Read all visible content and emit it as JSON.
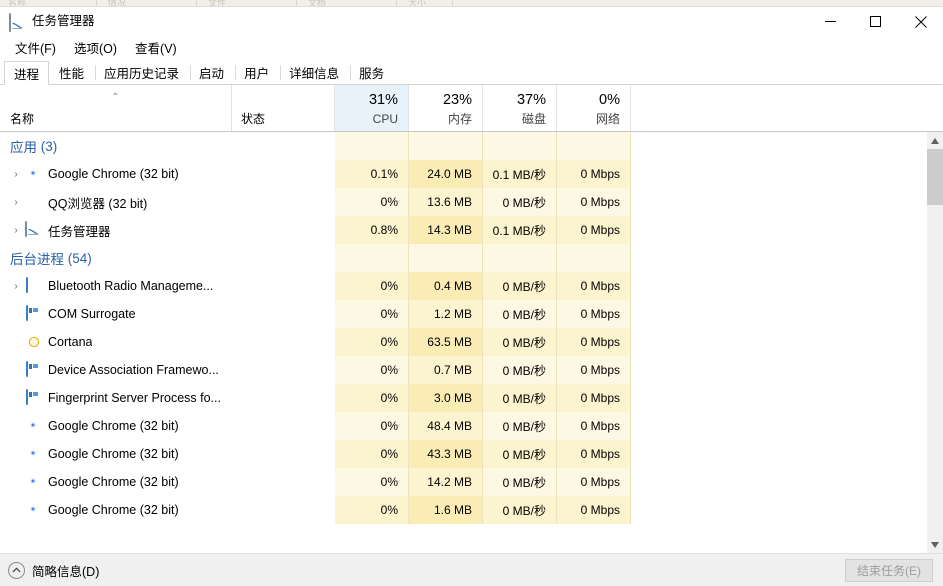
{
  "background_strip": {
    "segments": [
      "名称",
      "情况",
      "文件",
      "文档",
      "大小"
    ]
  },
  "window": {
    "title": "任务管理器",
    "icon": "task-manager-icon",
    "controls": {
      "minimize": "minimize-icon",
      "maximize": "maximize-icon",
      "close": "close-icon"
    }
  },
  "menu": {
    "items": [
      {
        "label": "文件(F)"
      },
      {
        "label": "选项(O)"
      },
      {
        "label": "查看(V)"
      }
    ]
  },
  "tabs": [
    {
      "label": "进程",
      "active": true
    },
    {
      "label": "性能",
      "active": false
    },
    {
      "label": "应用历史记录",
      "active": false
    },
    {
      "label": "启动",
      "active": false
    },
    {
      "label": "用户",
      "active": false
    },
    {
      "label": "详细信息",
      "active": false
    },
    {
      "label": "服务",
      "active": false
    }
  ],
  "columns": {
    "name": {
      "label": "名称",
      "sort": "ascending",
      "sort_glyph": "⌃"
    },
    "status": {
      "label": "状态"
    },
    "cpu": {
      "label": "CPU",
      "percent": "31%",
      "highlighted": true
    },
    "memory": {
      "label": "内存",
      "percent": "23%"
    },
    "disk": {
      "label": "磁盘",
      "percent": "37%"
    },
    "network": {
      "label": "网络",
      "percent": "0%"
    }
  },
  "groups": [
    {
      "label": "应用",
      "count": "(3)",
      "rows": [
        {
          "name": "Google Chrome (32 bit)",
          "icon": "chrome-icon",
          "expandable": true,
          "status": "",
          "cpu": "0.1%",
          "memory": "24.0 MB",
          "disk": "0.1 MB/秒",
          "network": "0 Mbps"
        },
        {
          "name": "QQ浏览器 (32 bit)",
          "icon": "qq-browser-icon",
          "expandable": true,
          "status": "",
          "cpu": "0%",
          "memory": "13.6 MB",
          "disk": "0 MB/秒",
          "network": "0 Mbps"
        },
        {
          "name": "任务管理器",
          "icon": "task-manager-icon",
          "expandable": true,
          "status": "",
          "cpu": "0.8%",
          "memory": "14.3 MB",
          "disk": "0.1 MB/秒",
          "network": "0 Mbps"
        }
      ]
    },
    {
      "label": "后台进程",
      "count": "(54)",
      "rows": [
        {
          "name": "Bluetooth Radio Manageme...",
          "icon": "window-icon",
          "expandable": true,
          "status": "",
          "cpu": "0%",
          "memory": "0.4 MB",
          "disk": "0 MB/秒",
          "network": "0 Mbps"
        },
        {
          "name": "COM Surrogate",
          "icon": "app-icon",
          "expandable": false,
          "status": "",
          "cpu": "0%",
          "memory": "1.2 MB",
          "disk": "0 MB/秒",
          "network": "0 Mbps"
        },
        {
          "name": "Cortana",
          "icon": "cortana-icon",
          "expandable": false,
          "status": "",
          "cpu": "0%",
          "memory": "63.5 MB",
          "disk": "0 MB/秒",
          "network": "0 Mbps"
        },
        {
          "name": "Device Association Framewo...",
          "icon": "app-icon",
          "expandable": false,
          "status": "",
          "cpu": "0%",
          "memory": "0.7 MB",
          "disk": "0 MB/秒",
          "network": "0 Mbps"
        },
        {
          "name": "Fingerprint Server Process fo...",
          "icon": "app-icon",
          "expandable": false,
          "status": "",
          "cpu": "0%",
          "memory": "3.0 MB",
          "disk": "0 MB/秒",
          "network": "0 Mbps"
        },
        {
          "name": "Google Chrome (32 bit)",
          "icon": "chrome-icon",
          "expandable": false,
          "status": "",
          "cpu": "0%",
          "memory": "48.4 MB",
          "disk": "0 MB/秒",
          "network": "0 Mbps"
        },
        {
          "name": "Google Chrome (32 bit)",
          "icon": "chrome-icon",
          "expandable": false,
          "status": "",
          "cpu": "0%",
          "memory": "43.3 MB",
          "disk": "0 MB/秒",
          "network": "0 Mbps"
        },
        {
          "name": "Google Chrome (32 bit)",
          "icon": "chrome-icon",
          "expandable": false,
          "status": "",
          "cpu": "0%",
          "memory": "14.2 MB",
          "disk": "0 MB/秒",
          "network": "0 Mbps"
        },
        {
          "name": "Google Chrome (32 bit)",
          "icon": "chrome-icon",
          "expandable": false,
          "status": "",
          "cpu": "0%",
          "memory": "1.6 MB",
          "disk": "0 MB/秒",
          "network": "0 Mbps"
        }
      ]
    }
  ],
  "statusbar": {
    "fewer_details": "简略信息(D)",
    "fewer_details_icon": "chevron-up-circle-icon",
    "end_task": "结束任务(E)",
    "end_task_enabled": false
  },
  "colors": {
    "accent_blue": "#2a62a8",
    "cpu_header_highlight": "#e8f2fb",
    "heat_light": "#fdf8e3",
    "heat_medium": "#fcf3cf",
    "heat_strong": "#faecb4"
  }
}
